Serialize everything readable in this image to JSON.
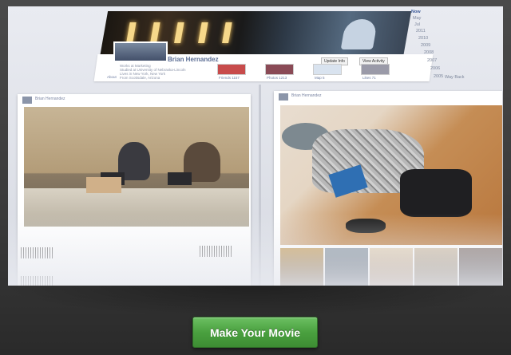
{
  "profile": {
    "name": "Brian Hernandez",
    "update_info": "Update Info",
    "view_activity": "View Activity",
    "info_lines": [
      "Works at Marketing",
      "Studied at University of Nebraska-Lincoln",
      "Lives in New York, New York",
      "From Scottsdale, Arizona"
    ],
    "about": "About",
    "thumbs": [
      {
        "label": "Friends 1157",
        "color": "#c84b4b"
      },
      {
        "label": "Photos 1213",
        "color": "#8a4a56"
      },
      {
        "label": "Map 5",
        "color": "#d9e3ef"
      },
      {
        "label": "Likes 71",
        "color": "#9a9aa8"
      }
    ]
  },
  "year_nav": {
    "items": [
      "Now",
      "May",
      "Jul",
      "2011",
      "2010",
      "2009",
      "2008",
      "2007",
      "2006",
      "2005",
      "Way Back"
    ],
    "active": "Now"
  },
  "cards": {
    "left": {
      "author": "Brian Hernandez"
    },
    "right": {
      "author": "Brian Hernandez"
    }
  },
  "cta": {
    "label": "Make Your Movie",
    "color": "#4aa03f"
  }
}
